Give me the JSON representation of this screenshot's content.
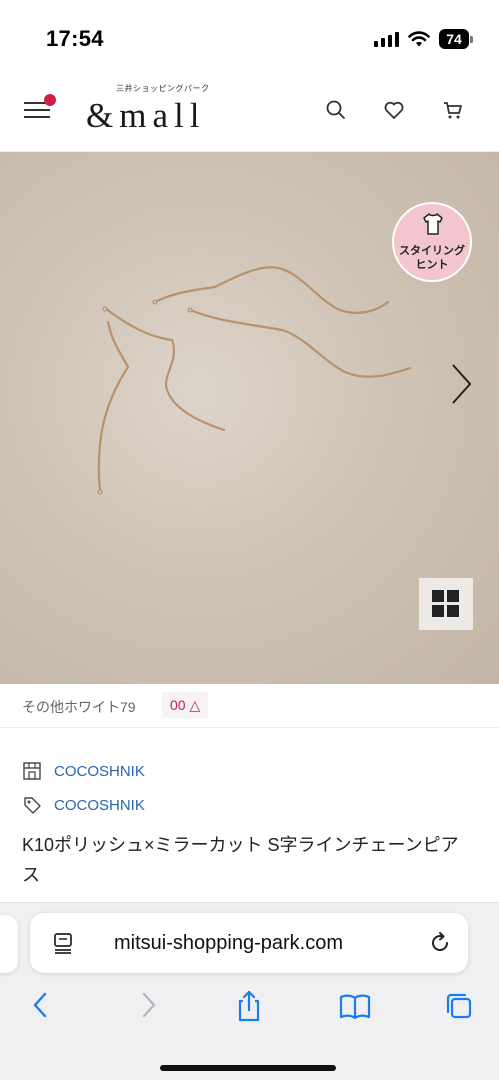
{
  "status_bar": {
    "time": "17:54",
    "battery": "74"
  },
  "header": {
    "logo_sub": "三井ショッピングパーク",
    "logo_main": "&mall",
    "icons": [
      "menu-icon",
      "search-icon",
      "heart-icon",
      "cart-icon"
    ]
  },
  "gallery": {
    "styling_badge_line1": "スタイリング",
    "styling_badge_line2": "ヒント",
    "icons": [
      "shirt-icon",
      "chevron-right-icon",
      "grid-icon"
    ]
  },
  "color_option": {
    "name": "その他ホワイト79",
    "stock": "00 △"
  },
  "product": {
    "shop": "COCOSHNIK",
    "brand": "COCOSHNIK",
    "title": "K10ポリッシュ×ミラーカット S字ラインチェーンピアス"
  },
  "browser": {
    "url": "mitsui-shopping-park.com",
    "icons": [
      "reader-icon",
      "reload-icon",
      "back-icon",
      "forward-icon",
      "share-icon",
      "bookmarks-icon",
      "tabs-icon"
    ]
  },
  "colors": {
    "accent_red": "#d21e45",
    "link_blue": "#2b65ac",
    "ios_blue": "#1a7cf0",
    "badge_pink": "#f3c6cf"
  }
}
